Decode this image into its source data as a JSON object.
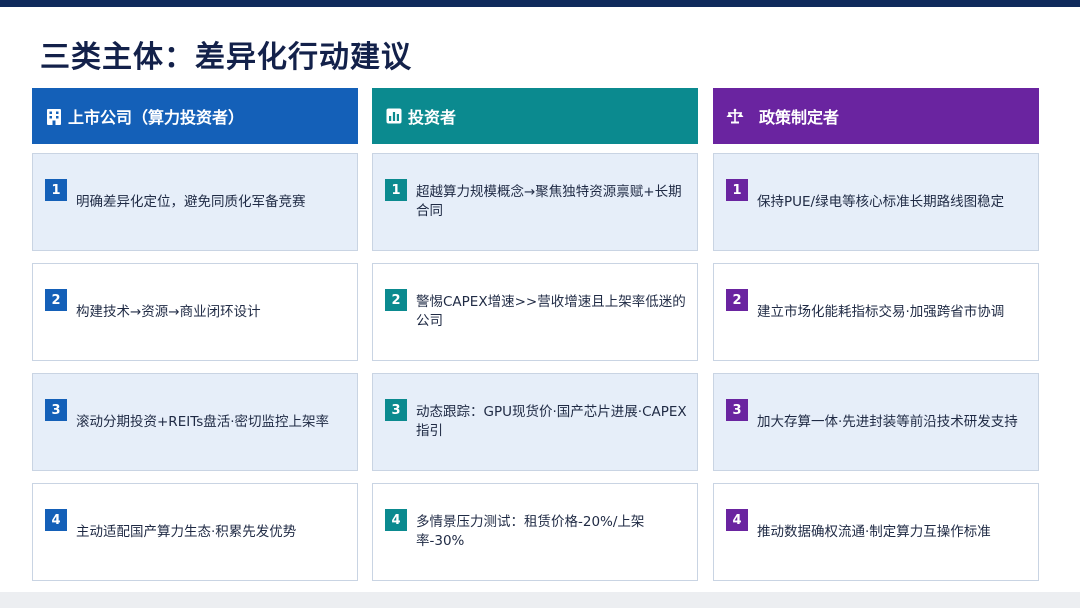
{
  "title": "三类主体：差异化行动建议",
  "colors": {
    "blue": "#1460b8",
    "teal": "#0b8a8f",
    "purple": "#6a24a0"
  },
  "columns": [
    {
      "icon": "building-icon",
      "header": "上市公司（算力投资者）",
      "items": [
        {
          "num": "1",
          "text": "明确差异化定位，避免同质化军备竞赛"
        },
        {
          "num": "2",
          "text": "构建技术→资源→商业闭环设计"
        },
        {
          "num": "3",
          "text": "滚动分期投资+REITs盘活·密切监控上架率"
        },
        {
          "num": "4",
          "text": "主动适配国产算力生态·积累先发优势"
        }
      ]
    },
    {
      "icon": "bar-chart-icon",
      "header": "投资者",
      "items": [
        {
          "num": "1",
          "text": "超越算力规模概念→聚焦独特资源禀赋+长期合同"
        },
        {
          "num": "2",
          "text": "警惕CAPEX增速>>营收增速且上架率低迷的公司"
        },
        {
          "num": "3",
          "text": "动态跟踪：GPU现货价·国产芯片进展·CAPEX指引"
        },
        {
          "num": "4",
          "text": "多情景压力测试：租赁价格-20%/上架率-30%"
        }
      ]
    },
    {
      "icon": "balance-scale-icon",
      "header": "政策制定者",
      "items": [
        {
          "num": "1",
          "text": "保持PUE/绿电等核心标准长期路线图稳定"
        },
        {
          "num": "2",
          "text": "建立市场化能耗指标交易·加强跨省市协调"
        },
        {
          "num": "3",
          "text": "加大存算一体·先进封装等前沿技术研发支持"
        },
        {
          "num": "4",
          "text": "推动数据确权流通·制定算力互操作标准"
        }
      ]
    }
  ]
}
